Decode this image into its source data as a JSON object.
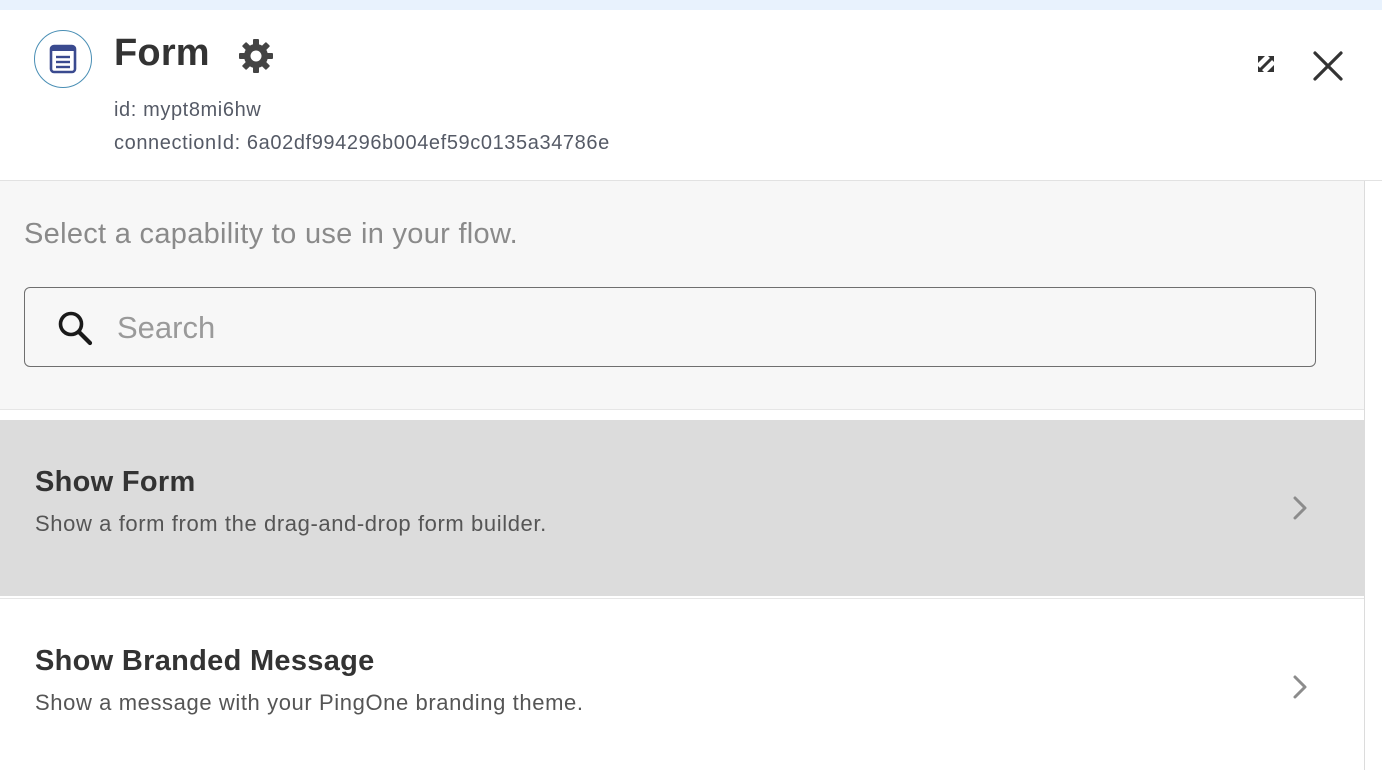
{
  "header": {
    "title": "Form",
    "id_text": "id: mypt8mi6hw",
    "connection_text": "connectionId: 6a02df994296b004ef59c0135a34786e",
    "node_icon": "form-document-icon",
    "settings_icon": "gear-icon",
    "expand_icon": "collapse-arrows-icon",
    "close_icon": "close-icon"
  },
  "panel": {
    "hint": "Select a capability to use in your flow.",
    "search": {
      "placeholder": "Search",
      "value": "",
      "icon": "search-icon"
    },
    "capabilities": [
      {
        "title": "Show Form",
        "description": "Show a form from the drag-and-drop form builder.",
        "selected": true
      },
      {
        "title": "Show Branded Message",
        "description": "Show a message with your PingOne branding theme.",
        "selected": false
      }
    ]
  },
  "colors": {
    "accent_icon_border": "#4a8fb5",
    "icon_fill": "#3a4a8f",
    "selected_row": "#dcdcdc",
    "top_strip": "#e8f2fd"
  }
}
